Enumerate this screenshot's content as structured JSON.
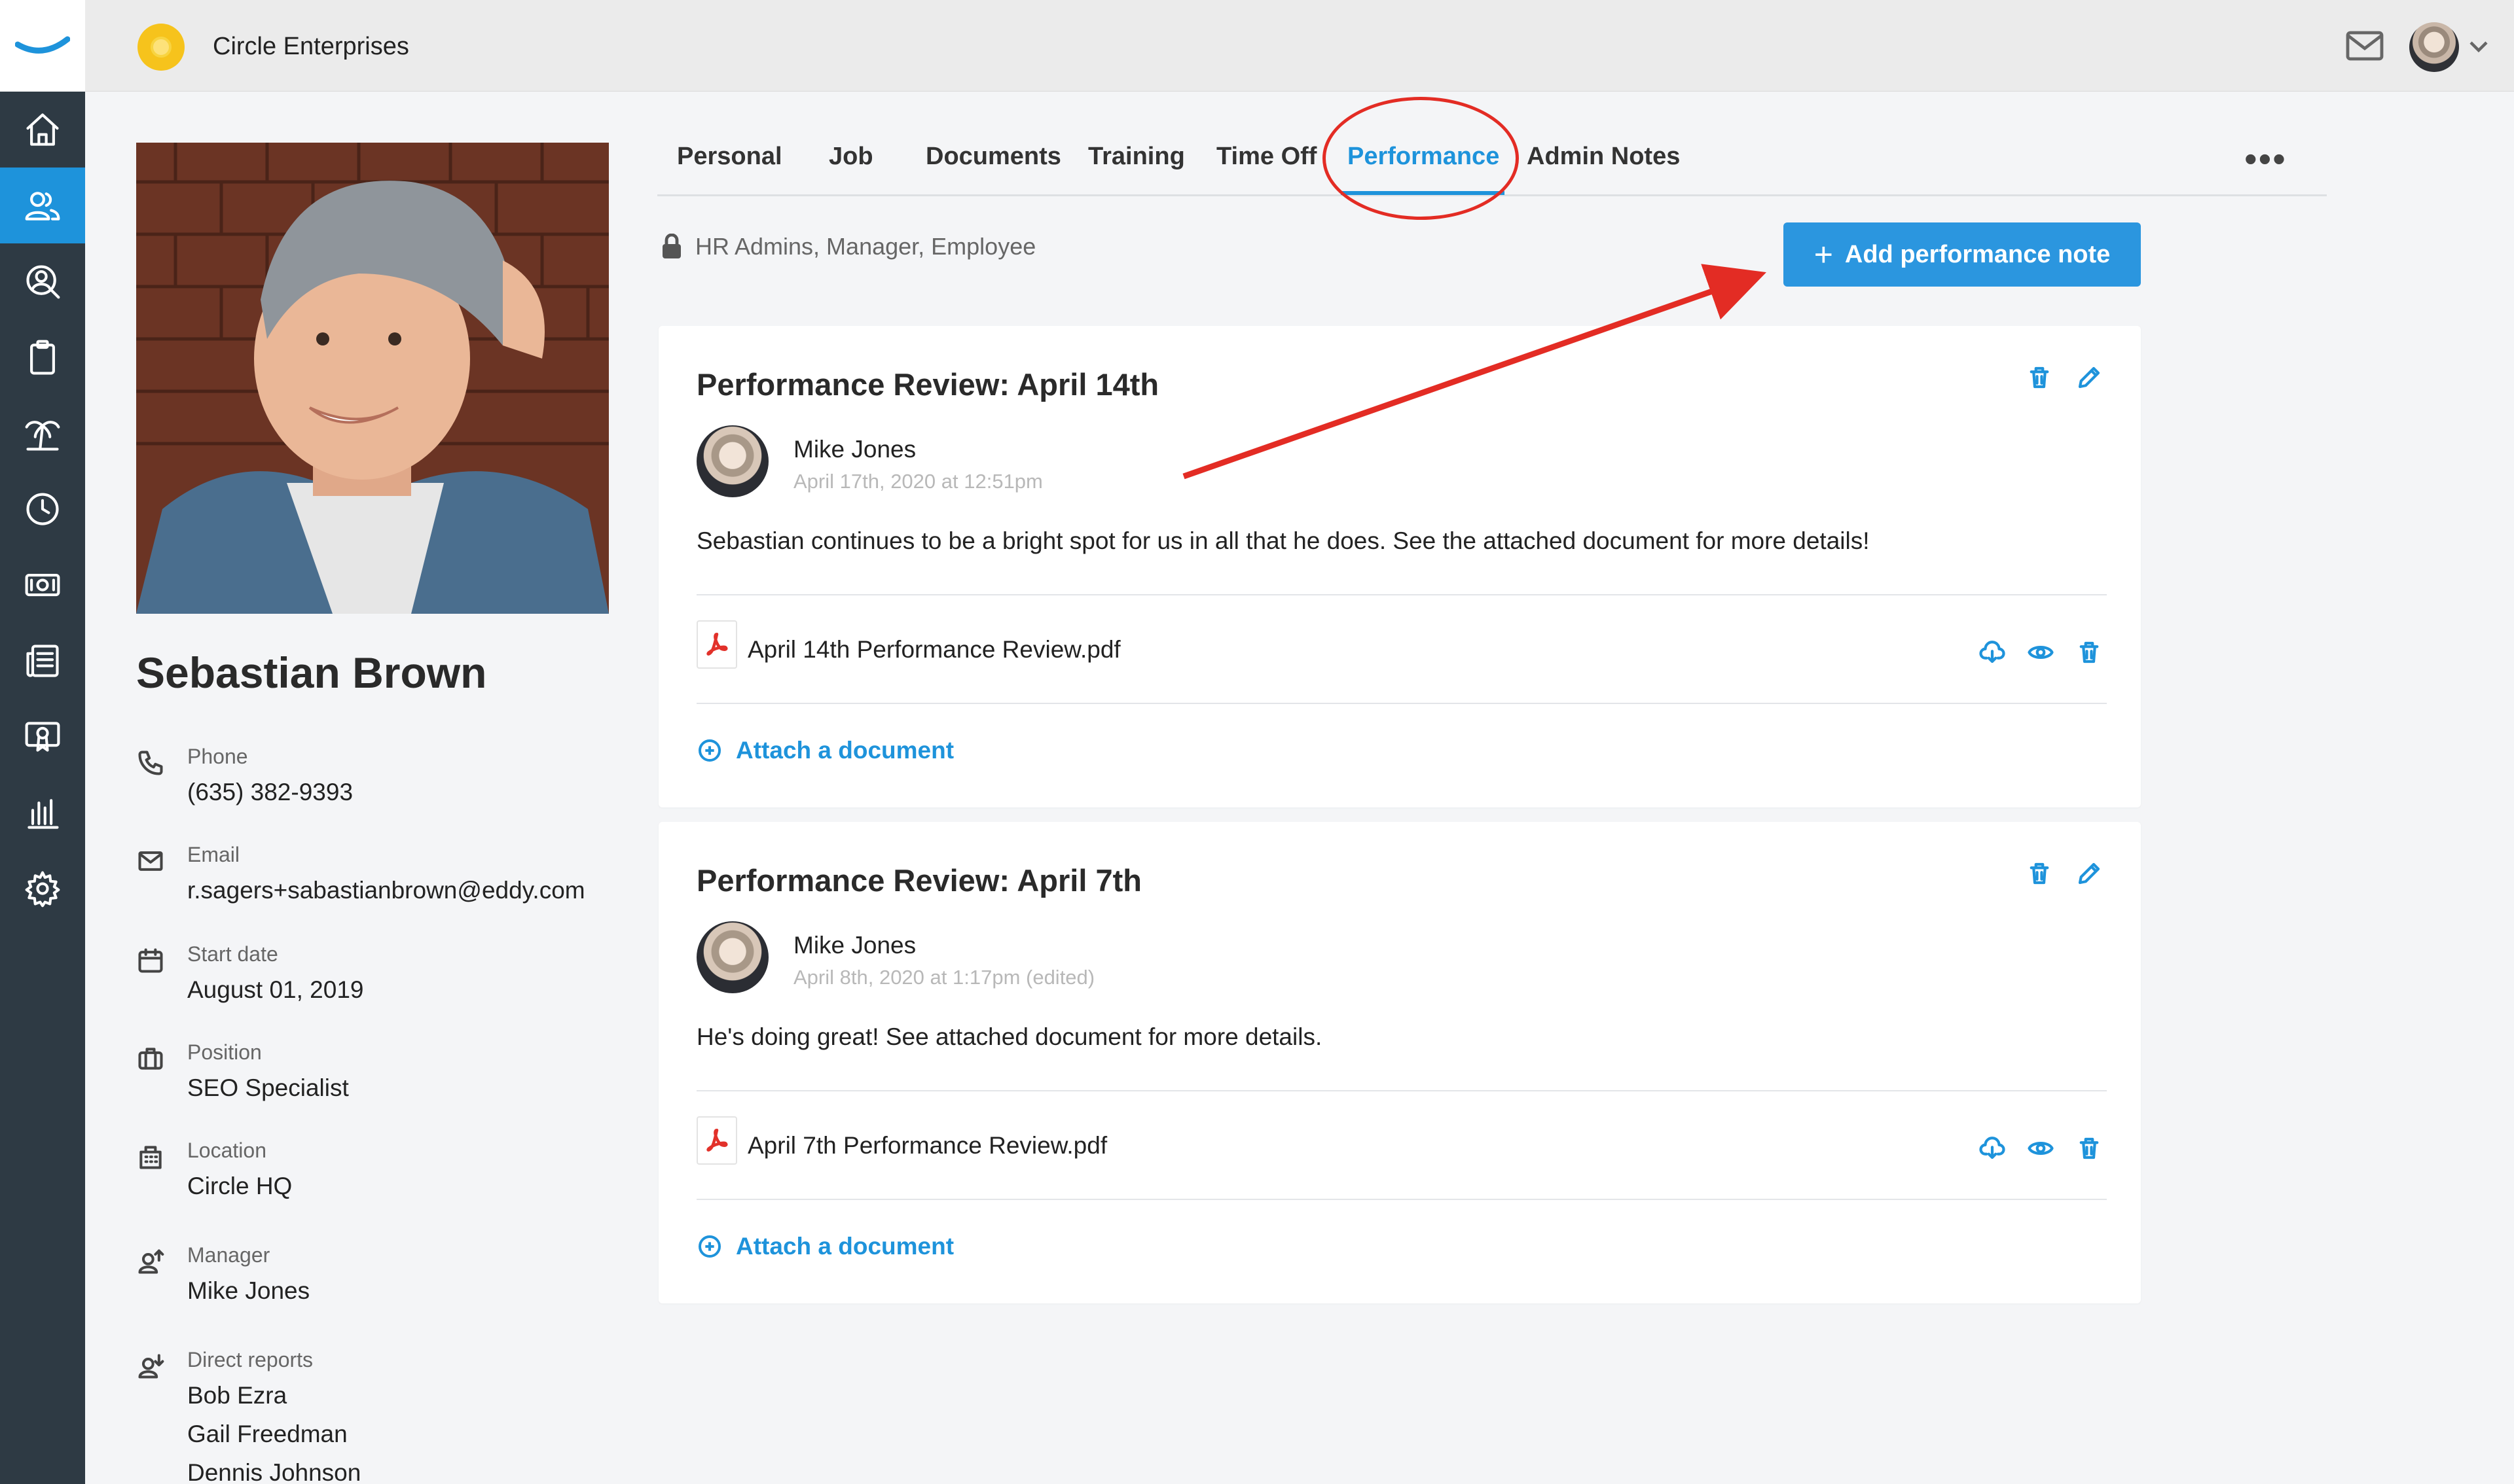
{
  "app": {
    "company_name": "Circle Enterprises",
    "accent_color": "#1e93db",
    "sidebar_color": "#2e3a44"
  },
  "topbar": {
    "icons": [
      "mail-icon",
      "user-avatar",
      "chevron-down-icon"
    ]
  },
  "nav": {
    "items": [
      {
        "icon": "home-icon"
      },
      {
        "icon": "people-icon",
        "active": true
      },
      {
        "icon": "search-person-icon"
      },
      {
        "icon": "clipboard-icon"
      },
      {
        "icon": "palm-tree-icon"
      },
      {
        "icon": "clock-icon"
      },
      {
        "icon": "money-icon"
      },
      {
        "icon": "newspaper-icon"
      },
      {
        "icon": "certificate-icon"
      },
      {
        "icon": "bar-chart-icon"
      },
      {
        "icon": "gear-icon"
      }
    ]
  },
  "profile": {
    "name": "Sebastian Brown",
    "phone_label": "Phone",
    "phone": "(635) 382-9393",
    "email_label": "Email",
    "email": "r.sagers+sabastianbrown@eddy.com",
    "start_label": "Start date",
    "start_date": "August 01, 2019",
    "position_label": "Position",
    "position": "SEO Specialist",
    "location_label": "Location",
    "location": "Circle HQ",
    "manager_label": "Manager",
    "manager": "Mike Jones",
    "reports_label": "Direct reports",
    "reports": [
      "Bob Ezra",
      "Gail Freedman",
      "Dennis Johnson"
    ]
  },
  "tabs": {
    "items": [
      "Personal",
      "Job",
      "Documents",
      "Training",
      "Time Off",
      "Performance",
      "Admin Notes"
    ],
    "active": "Performance",
    "more": "•••"
  },
  "performance": {
    "visibility": "HR Admins, Manager, Employee",
    "add_button": "Add performance note",
    "attach_label": "Attach a document",
    "notes": [
      {
        "title": "Performance Review: April 14th",
        "author": "Mike Jones",
        "date": "April 17th, 2020 at 12:51pm",
        "text": "Sebastian continues to be a bright spot for us in all that he does. See the attached document for more details!",
        "file": "April 14th Performance Review.pdf"
      },
      {
        "title": "Performance Review: April 7th",
        "author": "Mike Jones",
        "date": "April 8th, 2020 at 1:17pm (edited)",
        "text": "He's doing great! See attached document for more details.",
        "file": "April 7th Performance Review.pdf"
      }
    ]
  },
  "annotations": {
    "color": "#e32c24"
  }
}
